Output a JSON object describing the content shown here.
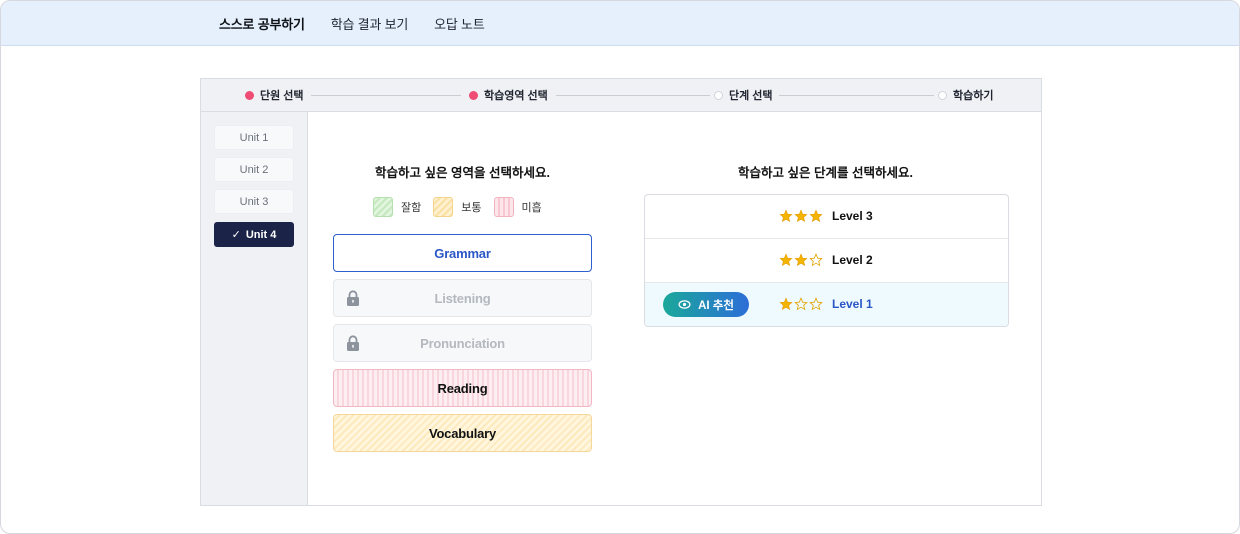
{
  "topnav": {
    "items": [
      {
        "label": "스스로 공부하기",
        "active": true
      },
      {
        "label": "학습 결과 보기",
        "active": false
      },
      {
        "label": "오답 노트",
        "active": false
      }
    ]
  },
  "stepper": {
    "steps": [
      {
        "label": "단원 선택",
        "done": true
      },
      {
        "label": "학습영역 선택",
        "done": true
      },
      {
        "label": "단계 선택",
        "done": false
      },
      {
        "label": "학습하기",
        "done": false
      }
    ]
  },
  "units": [
    {
      "label": "Unit 1",
      "active": false
    },
    {
      "label": "Unit 2",
      "active": false
    },
    {
      "label": "Unit 3",
      "active": false
    },
    {
      "label": "Unit 4",
      "active": true,
      "check": "✓"
    }
  ],
  "area": {
    "title": "학습하고 싶은 영역을 선택하세요.",
    "legend": [
      {
        "label": "잘함",
        "color": "#c5e8bf"
      },
      {
        "label": "보통",
        "color": "#fbe0a6"
      },
      {
        "label": "미흡",
        "color": "#f7c6d0"
      }
    ],
    "options": [
      {
        "label": "Grammar",
        "state": "selected"
      },
      {
        "label": "Listening",
        "state": "locked",
        "icon": "lock-icon"
      },
      {
        "label": "Pronunciation",
        "state": "locked",
        "icon": "lock-icon"
      },
      {
        "label": "Reading",
        "state": "low"
      },
      {
        "label": "Vocabulary",
        "state": "mid"
      }
    ]
  },
  "level": {
    "title": "학습하고 싶은 단계를 선택하세요.",
    "options": [
      {
        "label": "Level 3",
        "stars": 3
      },
      {
        "label": "Level 2",
        "stars": 2
      },
      {
        "label": "Level 1",
        "stars": 1,
        "recommended": true
      }
    ],
    "ai_badge": "AI 추천"
  },
  "colors": {
    "accent_blue": "#2a56c6",
    "step_active": "#ef4d75",
    "unit_active_bg": "#1b2448",
    "star": "#f5b400"
  }
}
